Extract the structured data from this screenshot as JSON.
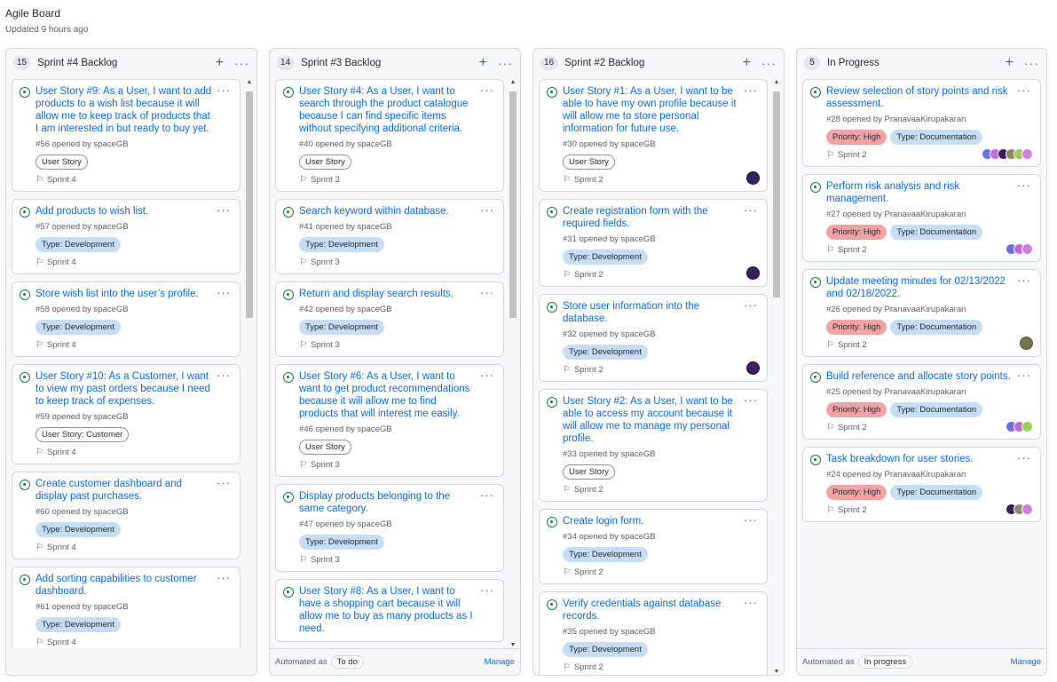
{
  "board": {
    "title": "Agile Board",
    "updated": "Updated 9 hours ago"
  },
  "footer": {
    "automated_as": "Automated as",
    "manage": "Manage"
  },
  "columns": [
    {
      "name": "Sprint #4 Backlog",
      "count": "15",
      "cards": [
        {
          "title": "User Story #9: As a User, I want to add products to a wish list because it will allow me to keep track of products that I am interested in but ready to buy yet.",
          "meta": "#56 opened by spaceGB",
          "labels": [
            "User Story"
          ],
          "milestone": "Sprint 4"
        },
        {
          "title": "Add products to wish list.",
          "meta": "#57 opened by spaceGB",
          "labels": [
            "Type: Development"
          ],
          "milestone": "Sprint 4"
        },
        {
          "title": "Store wish list into the user’s profile.",
          "meta": "#58 opened by spaceGB",
          "labels": [
            "Type: Development"
          ],
          "milestone": "Sprint 4"
        },
        {
          "title": "User Story #10: As a Customer, I want to view my past orders because I need to keep track of expenses.",
          "meta": "#59 opened by spaceGB",
          "labels": [
            "User Story: Customer"
          ],
          "milestone": "Sprint 4"
        },
        {
          "title": "Create customer dashboard and display past purchases.",
          "meta": "#60 opened by spaceGB",
          "labels": [
            "Type: Development"
          ],
          "milestone": "Sprint 4"
        },
        {
          "title": "Add sorting capabilities to customer dashboard.",
          "meta": "#61 opened by spaceGB",
          "labels": [
            "Type: Development"
          ],
          "milestone": "Sprint 4"
        }
      ]
    },
    {
      "name": "Sprint #3 Backlog",
      "count": "14",
      "automation": "To do",
      "cards": [
        {
          "title": "User Story #4: As a User, I want to search through the product catalogue because I can find specific items without specifying additional criteria.",
          "meta": "#40 opened by spaceGB",
          "labels": [
            "User Story"
          ],
          "milestone": "Sprint 3"
        },
        {
          "title": "Search keyword within database.",
          "meta": "#41 opened by spaceGB",
          "labels": [
            "Type: Development"
          ],
          "milestone": "Sprint 3"
        },
        {
          "title": "Return and display search results.",
          "meta": "#42 opened by spaceGB",
          "labels": [
            "Type: Development"
          ],
          "milestone": "Sprint 3"
        },
        {
          "title": "User Story #6: As a User, I want to want to get product recommendations because it will allow me to find products that will interest me easily.",
          "meta": "#46 opened by spaceGB",
          "labels": [
            "User Story"
          ],
          "milestone": "Sprint 3"
        },
        {
          "title": "Display products belonging to the same category.",
          "meta": "#47 opened by spaceGB",
          "labels": [
            "Type: Development"
          ],
          "milestone": "Sprint 3"
        },
        {
          "title": "User Story #8: As a User, I want to have a shopping cart because it will allow me to buy as many products as I need.",
          "meta": "",
          "labels": [],
          "milestone": ""
        }
      ]
    },
    {
      "name": "Sprint #2 Backlog",
      "count": "16",
      "cards": [
        {
          "title": "User Story #1: As a User, I want to be able to have my own profile because it will allow me to store personal information for future use.",
          "meta": "#30 opened by spaceGB",
          "labels": [
            "User Story"
          ],
          "milestone": "Sprint 2"
        },
        {
          "title": "Create registration form with the required fields.",
          "meta": "#31 opened by spaceGB",
          "labels": [
            "Type: Development"
          ],
          "milestone": "Sprint 2"
        },
        {
          "title": "Store user information into the database.",
          "meta": "#32 opened by spaceGB",
          "labels": [
            "Type: Development"
          ],
          "milestone": "Sprint 2"
        },
        {
          "title": "User Story #2: As a User, I want to be able to access my account because it will allow me to manage my personal profile.",
          "meta": "#33 opened by spaceGB",
          "labels": [
            "User Story"
          ],
          "milestone": "Sprint 2"
        },
        {
          "title": "Create login form.",
          "meta": "#34 opened by spaceGB",
          "labels": [
            "Type: Development"
          ],
          "milestone": "Sprint 2"
        },
        {
          "title": "Verify credentials against database records.",
          "meta": "#35 opened by spaceGB",
          "labels": [
            "Type: Development"
          ],
          "milestone": "Sprint 2"
        }
      ]
    },
    {
      "name": "In Progress",
      "count": "5",
      "automation": "In progress",
      "cards": [
        {
          "title": "Review selection of story points and risk assessment.",
          "meta": "#28 opened by PranavaaKirupakaran",
          "labels": [
            "Priority: High",
            "Type: Documentation"
          ],
          "milestone": "Sprint 2"
        },
        {
          "title": "Perform risk analysis and risk management.",
          "meta": "#27 opened by PranavaaKirupakaran",
          "labels": [
            "Priority: High",
            "Type: Documentation"
          ],
          "milestone": "Sprint 2"
        },
        {
          "title": "Update meeting minutes for 02/13/2022 and 02/18/2022.",
          "meta": "#26 opened by PranavaaKirupakaran",
          "labels": [
            "Priority: High",
            "Type: Documentation"
          ],
          "milestone": "Sprint 2"
        },
        {
          "title": "Build reference and allocate story points.",
          "meta": "#25 opened by PranavaaKirupakaran",
          "labels": [
            "Priority: High",
            "Type: Documentation"
          ],
          "milestone": "Sprint 2"
        },
        {
          "title": "Task breakdown for user stories.",
          "meta": "#24 opened by PranavaaKirupakaran",
          "labels": [
            "Priority: High",
            "Type: Documentation"
          ],
          "milestone": "Sprint 2"
        }
      ]
    }
  ]
}
